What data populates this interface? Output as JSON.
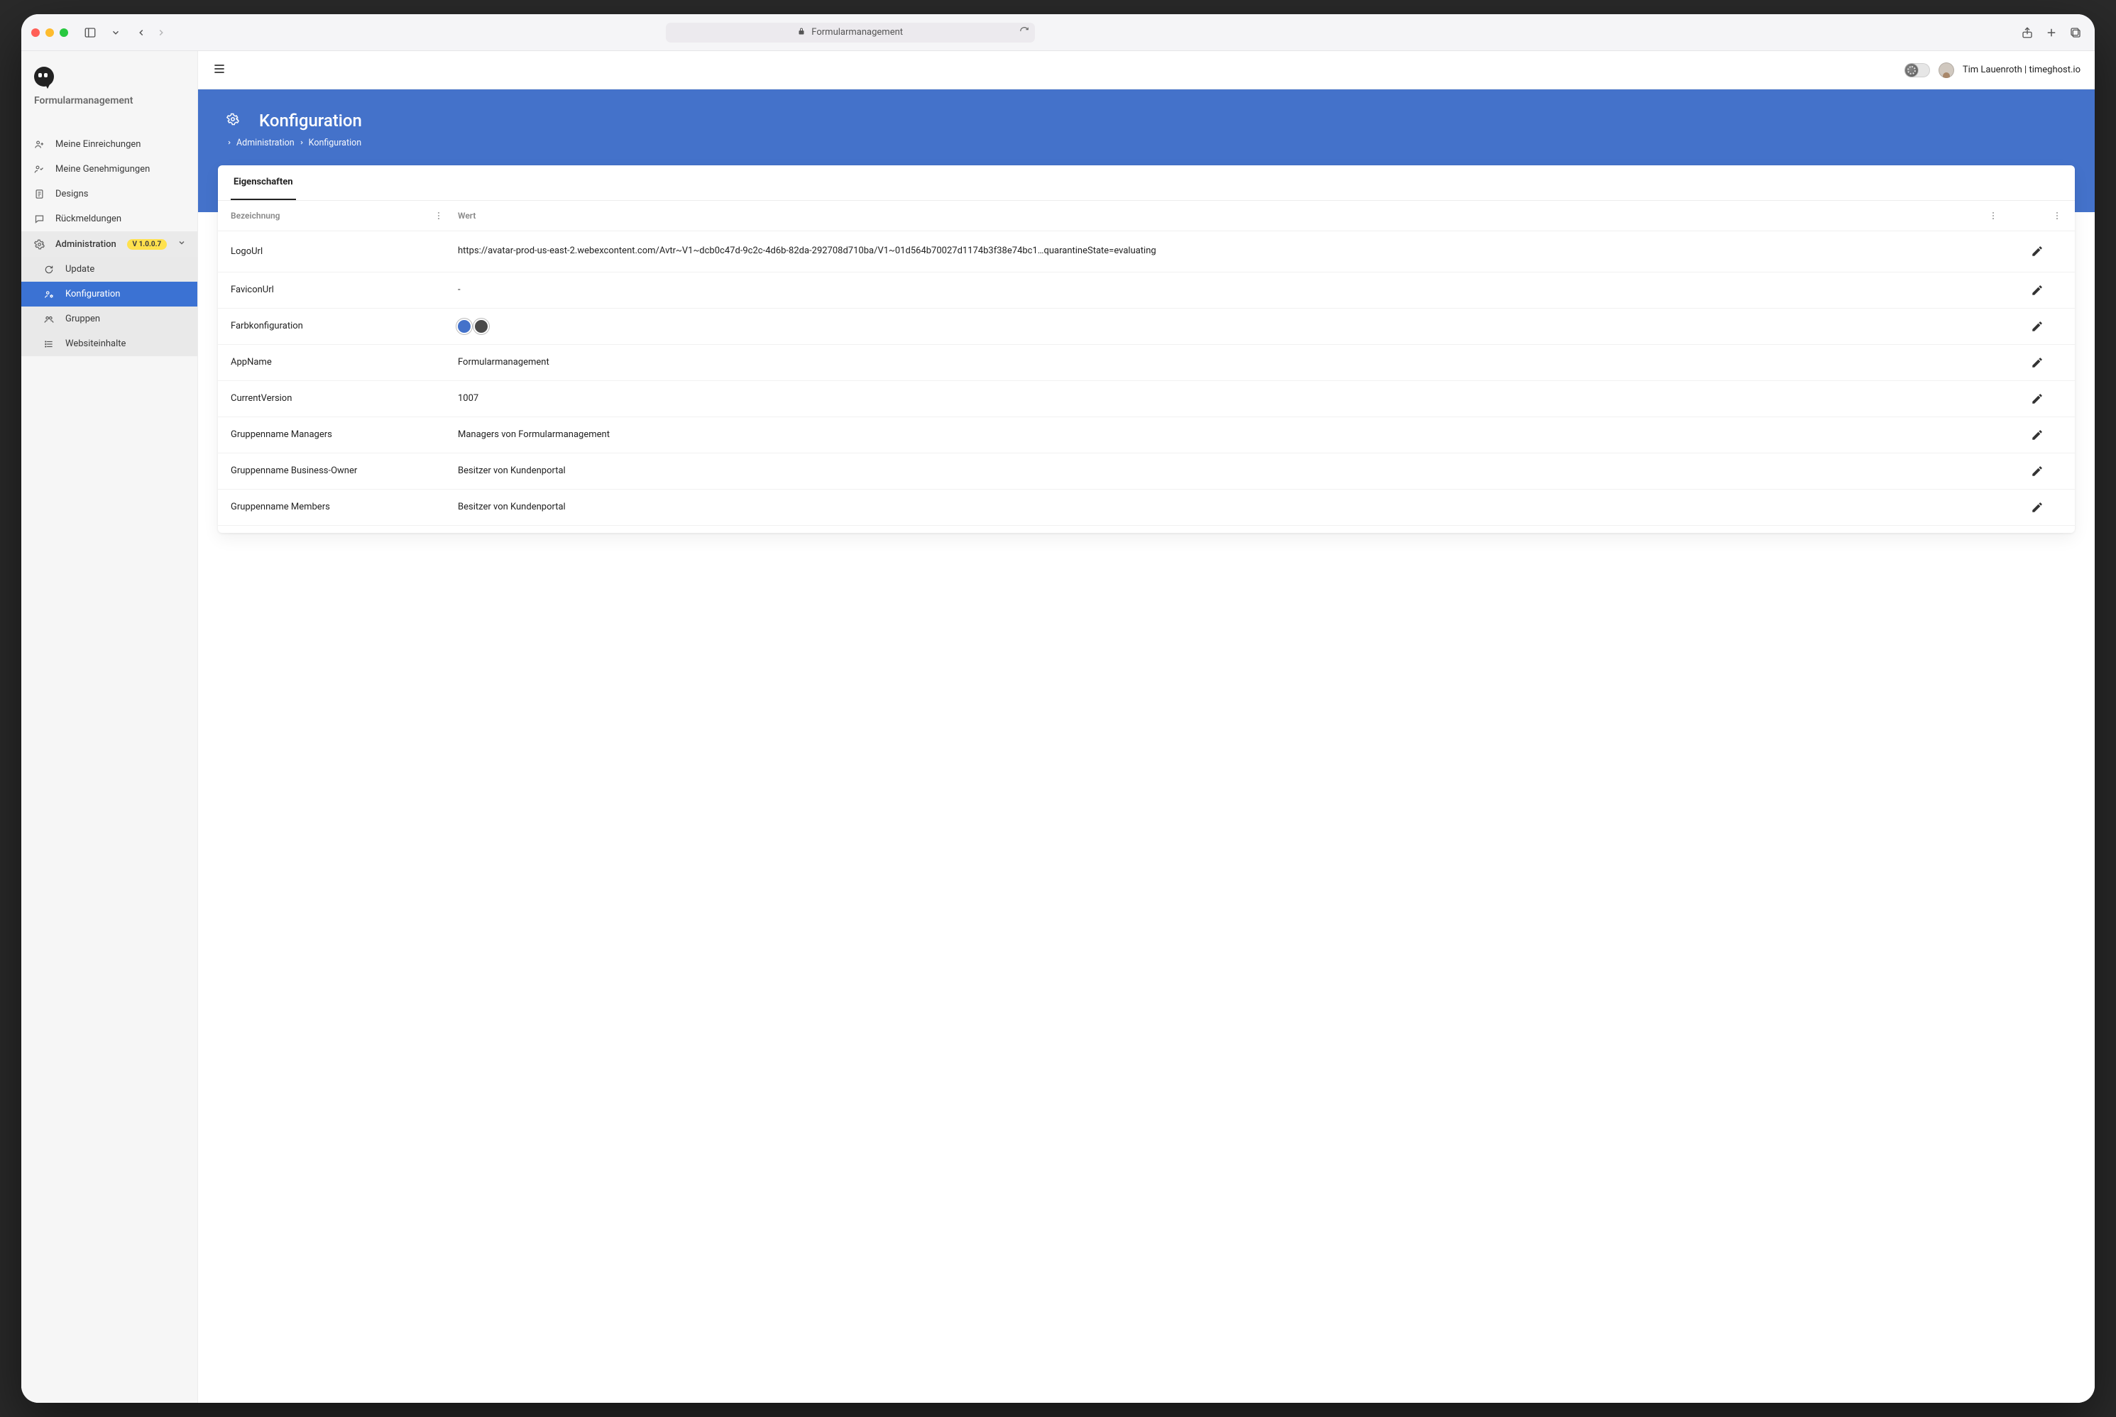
{
  "browser": {
    "title": "Formularmanagement"
  },
  "app": {
    "brand": "Formularmanagement",
    "user_label": "Tim Lauenroth | timeghost.io"
  },
  "sidebar": {
    "version_pill": "V 1.0.0.7",
    "items": {
      "submissions": "Meine Einreichungen",
      "approvals": "Meine Genehmigungen",
      "designs": "Designs",
      "feedback": "Rückmeldungen",
      "administration": "Administration"
    },
    "sub": {
      "update": "Update",
      "configuration": "Konfiguration",
      "groups": "Gruppen",
      "site_contents": "Websiteinhalte"
    }
  },
  "header": {
    "title": "Konfiguration",
    "crumb_admin": "Administration",
    "crumb_current": "Konfiguration"
  },
  "tabs": {
    "properties": "Eigenschaften"
  },
  "table": {
    "col_label": "Bezeichnung",
    "col_value": "Wert"
  },
  "rows": [
    {
      "label": "LogoUrl",
      "type": "text",
      "value": "https://avatar-prod-us-east-2.webexcontent.com/Avtr~V1~dcb0c47d-9c2c-4d6b-82da-292708d710ba/V1~01d564b70027d1174b3f38e74bc1…quarantineState=evaluating"
    },
    {
      "label": "FaviconUrl",
      "type": "text",
      "value": "-"
    },
    {
      "label": "Farbkonfiguration",
      "type": "colors",
      "colors": [
        "#4472ca",
        "#4a4a4a"
      ]
    },
    {
      "label": "AppName",
      "type": "text",
      "value": "Formularmanagement"
    },
    {
      "label": "CurrentVersion",
      "type": "text",
      "value": "1007"
    },
    {
      "label": "Gruppenname Managers",
      "type": "text",
      "value": "Managers von Formularmanagement"
    },
    {
      "label": "Gruppenname Business-Owner",
      "type": "text",
      "value": "Besitzer von Kundenportal"
    },
    {
      "label": "Gruppenname Members",
      "type": "text",
      "value": "Besitzer von Kundenportal"
    }
  ]
}
